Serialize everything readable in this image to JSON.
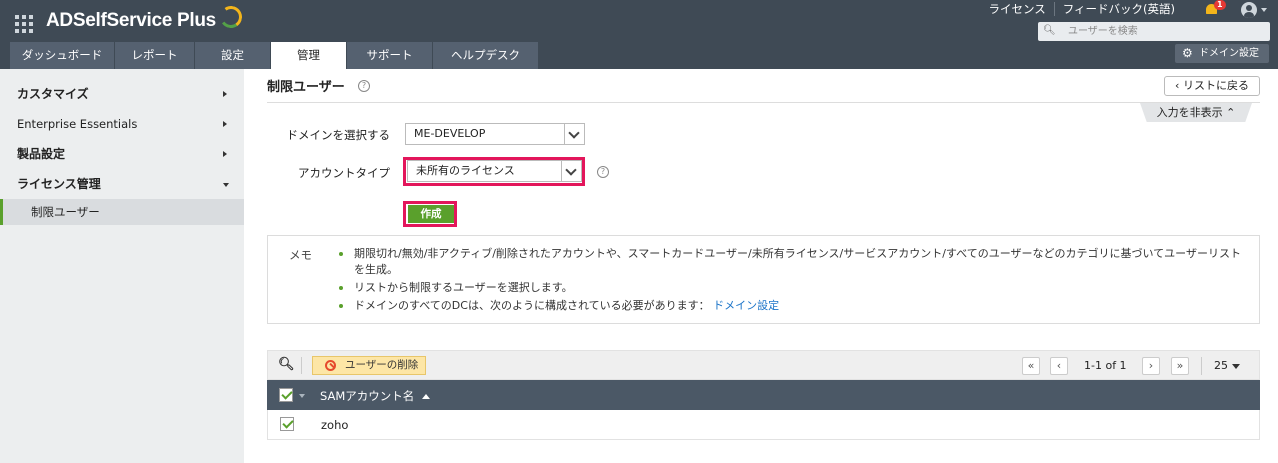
{
  "header": {
    "app_name": "ADSelfService Plus",
    "links": [
      "ライセンス",
      "フィードバック(英語)"
    ],
    "notification_count": "1",
    "search_placeholder": "ユーザーを検索",
    "domain_settings_label": "ドメイン設定",
    "tabs": [
      {
        "label": "ダッシュボード",
        "active": false
      },
      {
        "label": "レポート",
        "active": false
      },
      {
        "label": "設定",
        "active": false
      },
      {
        "label": "管理",
        "active": true
      },
      {
        "label": "サポート",
        "active": false
      },
      {
        "label": "ヘルプデスク",
        "active": false
      }
    ]
  },
  "sidebar": {
    "items": [
      {
        "label": "カスタマイズ",
        "expanded": false
      },
      {
        "label": "Enterprise Essentials",
        "expanded": false
      },
      {
        "label": "製品設定",
        "expanded": false
      },
      {
        "label": "ライセンス管理",
        "expanded": true
      }
    ],
    "sub_item": "制限ユーザー"
  },
  "main": {
    "title": "制限ユーザー",
    "back_label": "リストに戻る",
    "toggle_input_label": "入力を非表示",
    "domain_label": "ドメインを選択する",
    "domain_value": "ME-DEVELOP",
    "account_type_label": "アカウントタイプ",
    "account_type_value": "未所有のライセンス",
    "create_label": "作成",
    "memo_label": "メモ",
    "memo_items": [
      "期限切れ/無効/非アクティブ/削除されたアカウントや、スマートカードユーザー/未所有ライセンス/サービスアカウント/すべてのユーザーなどのカテゴリに基づいてユーザーリストを生成。",
      "リストから制限するユーザーを選択します。",
      "ドメインのすべてのDCは、次のように構成されている必要があります："
    ],
    "memo_link": "ドメイン設定",
    "toolbar": {
      "delete_label": "ユーザーの削除",
      "page_info": "1-1 of 1",
      "per_page": "25"
    },
    "table": {
      "column": "SAMアカウント名",
      "rows": [
        {
          "sam": "zoho",
          "checked": true
        }
      ]
    }
  },
  "colors": {
    "header_bg": "#3f4a55",
    "accent_green": "#5aa02c",
    "highlight_red": "#e3165b",
    "link_blue": "#1a73c8"
  }
}
